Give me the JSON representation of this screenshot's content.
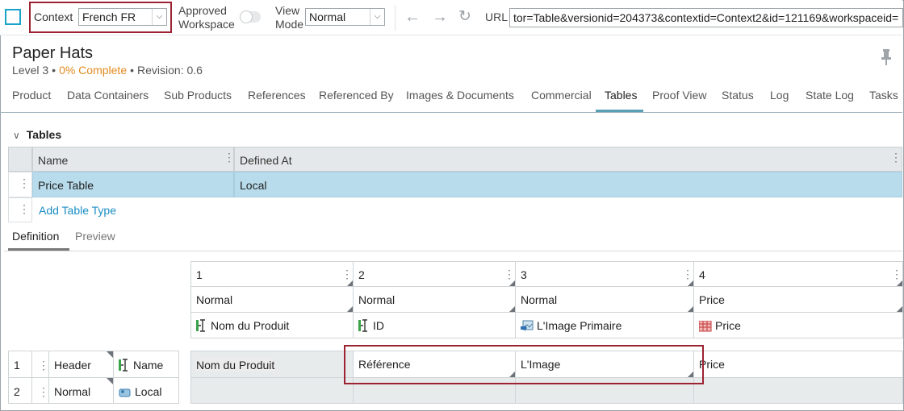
{
  "toolbar": {
    "context_label": "Context",
    "context_value": "French FR",
    "approved_label_1": "Approved",
    "approved_label_2": "Workspace",
    "view_label_1": "View",
    "view_label_2": "Mode",
    "view_mode_value": "Normal",
    "url_label": "URL",
    "url_value": "tor=Table&versionid=204373&contextid=Context2&id=121169&workspaceid="
  },
  "header": {
    "title": "Paper Hats",
    "level": "Level 3",
    "complete": "0% Complete",
    "revision": "Revision: 0.6"
  },
  "tabs": [
    "Product",
    "Data Containers",
    "Sub Products",
    "References",
    "Referenced By",
    "Images & Documents",
    "Commercial",
    "Tables",
    "Proof View",
    "Status",
    "Log",
    "State Log",
    "Tasks"
  ],
  "tables_section": {
    "title": "Tables",
    "columns": [
      "Name",
      "Defined At"
    ],
    "rows": [
      {
        "name": "Price Table",
        "defined_at": "Local"
      }
    ],
    "add_link": "Add Table Type"
  },
  "subtabs": [
    "Definition",
    "Preview"
  ],
  "definition": {
    "columns": [
      {
        "num": "1",
        "type": "Normal",
        "field": "Nom du Produit",
        "field_icon": "attribute-icon"
      },
      {
        "num": "2",
        "type": "Normal",
        "field": "ID",
        "field_icon": "attribute-icon"
      },
      {
        "num": "3",
        "type": "Normal",
        "field": "L'Image Primaire",
        "field_icon": "image-reference-icon"
      },
      {
        "num": "4",
        "type": "Price",
        "field": "Price",
        "field_icon": "price-table-icon"
      }
    ],
    "rows": [
      {
        "num": "1",
        "type": "Header",
        "field": "Name",
        "field_icon": "attribute-icon"
      },
      {
        "num": "2",
        "type": "Normal",
        "field": "Local",
        "field_icon": "local-context-icon"
      }
    ],
    "header_values": [
      "Nom du Produit",
      "Référence",
      "L'Image",
      "Price"
    ]
  },
  "colors": {
    "accent": "#1aa3c8",
    "highlight_border": "#9c2331",
    "selected_row": "#b8dcec",
    "orange": "#e38a1d",
    "link": "#1a8ec4"
  }
}
